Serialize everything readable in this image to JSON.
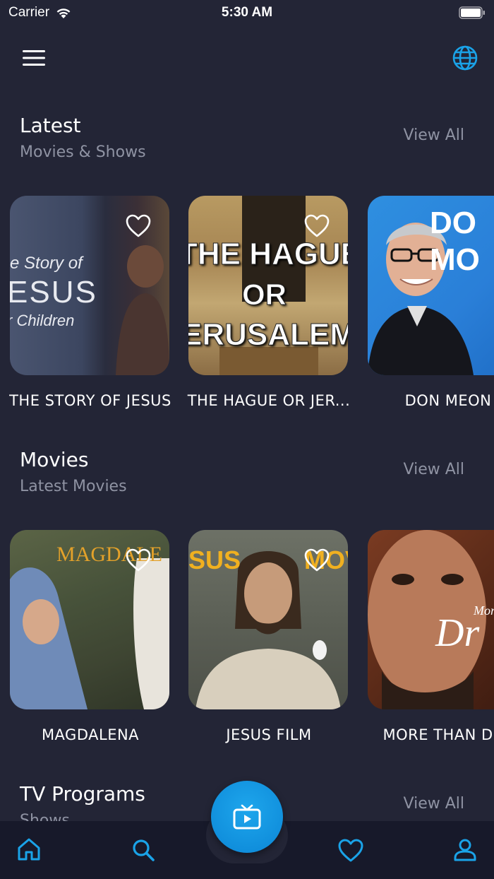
{
  "status": {
    "carrier": "Carrier",
    "time": "5:30 AM"
  },
  "sections": [
    {
      "title": "Latest",
      "subtitle": "Movies & Shows",
      "view_all": "View All",
      "cards": [
        {
          "title": "THE STORY OF JESUS",
          "poster_lines": [
            "e Story of",
            "ESUS",
            "r Children"
          ]
        },
        {
          "title": "THE HAGUE OR JER...",
          "poster_lines": [
            "THE HAGUE",
            "OR",
            "ERUSALEM"
          ]
        },
        {
          "title": "DON MEON",
          "poster_lines": [
            "DO",
            "MO"
          ]
        }
      ]
    },
    {
      "title": "Movies",
      "subtitle": "Latest Movies",
      "view_all": "View All",
      "cards": [
        {
          "title": "MAGDALENA",
          "poster_lines": [
            "MAGDALE"
          ]
        },
        {
          "title": "JESUS FILM",
          "poster_lines": [
            "SUS",
            "MOV"
          ]
        },
        {
          "title": "MORE THAN DRE",
          "poster_lines": [
            "More",
            "Dr"
          ]
        }
      ]
    },
    {
      "title": "TV Programs",
      "subtitle": "Shows",
      "view_all": "View All"
    }
  ],
  "nav": {
    "items": [
      "home-icon",
      "search-icon",
      "tv-icon",
      "heart-icon",
      "user-icon"
    ],
    "accent": "#1aa3e8"
  }
}
